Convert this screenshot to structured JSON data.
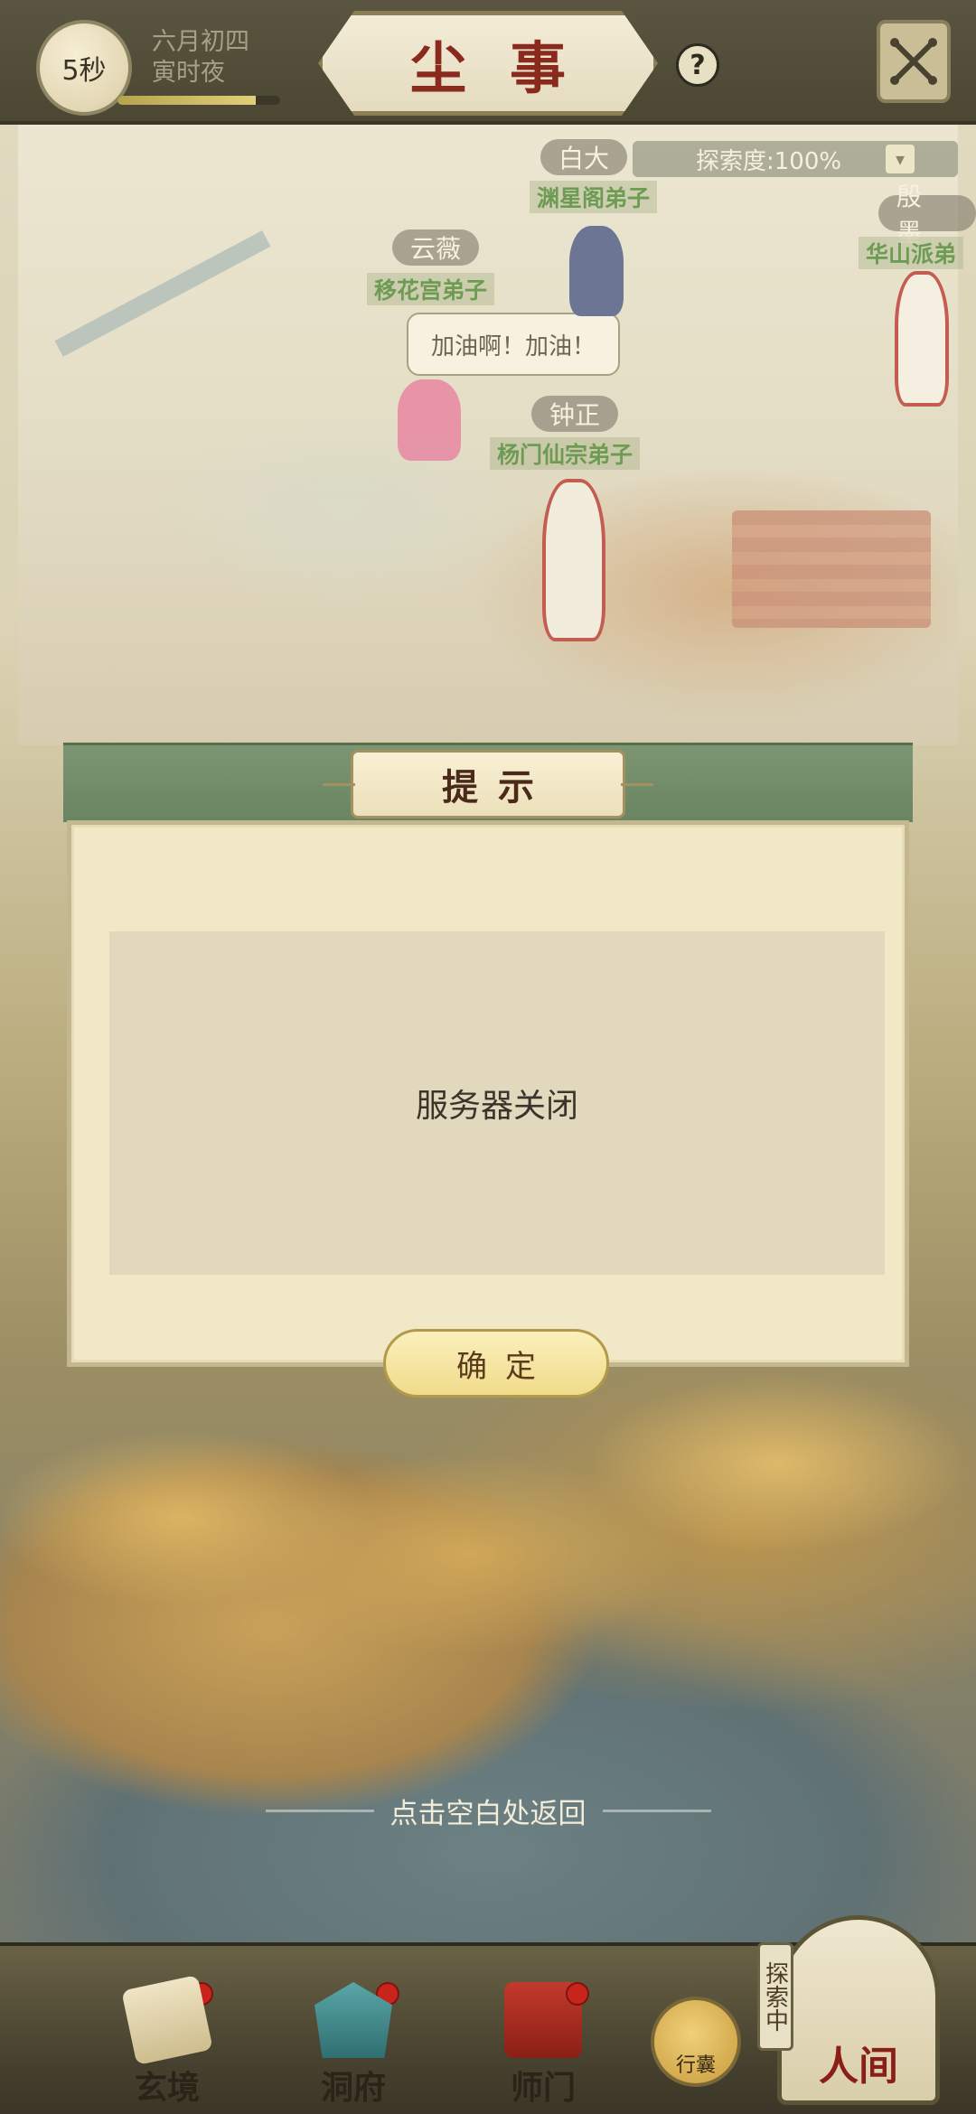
{
  "header": {
    "timer": "5秒",
    "date_line1": "六月初四",
    "date_line2": "寅时夜",
    "title": "尘事",
    "time_progress": 0.85
  },
  "scene": {
    "explore_label": "探索度:100%",
    "npcs": [
      {
        "name": "白大",
        "sect": "渊星阁弟子"
      },
      {
        "name": "殷墨",
        "sect": "华山派弟"
      },
      {
        "name": "云薇",
        "sect": "移花宫弟子"
      },
      {
        "name": "钟正",
        "sect": "杨门仙宗弟子"
      }
    ],
    "speech": "加油啊！加油！"
  },
  "dialog": {
    "title": "提示",
    "message": "服务器关闭",
    "confirm_label": "确定"
  },
  "tap_hint": "点击空白处返回",
  "bottom_nav": {
    "items": [
      {
        "label": "玄境",
        "icon": "scroll-icon",
        "badge": true
      },
      {
        "label": "洞府",
        "icon": "pavilion-icon",
        "badge": true
      },
      {
        "label": "师门",
        "icon": "banner-icon",
        "badge": true
      }
    ],
    "bag_label": "行囊",
    "exploring_tag": "探索中",
    "world_label": "人间"
  },
  "colors": {
    "title_red": "#8a2a1e",
    "dialog_header_green": "#7c9673",
    "badge_red": "#c9241b"
  }
}
